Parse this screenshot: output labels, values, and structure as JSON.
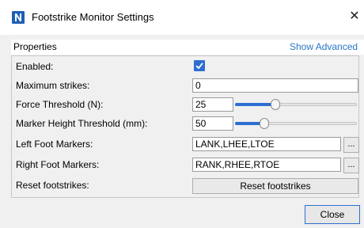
{
  "window": {
    "title": "Footstrike Monitor Settings",
    "close_symbol": "✕",
    "app_icon": "n-logo-icon"
  },
  "properties": {
    "header": "Properties",
    "show_advanced": "Show Advanced"
  },
  "rows": {
    "enabled": {
      "label": "Enabled:",
      "checked": true,
      "check_symbol": "✓"
    },
    "max_strikes": {
      "label": "Maximum strikes:",
      "value": "0"
    },
    "force": {
      "label": "Force Threshold (N):",
      "value": "25",
      "slider_fraction": 0.32
    },
    "marker_height": {
      "label": "Marker Height Threshold (mm):",
      "value": "50",
      "slider_fraction": 0.22
    },
    "left_foot": {
      "label": "Left Foot Markers:",
      "value": "LANK,LHEE,LTOE",
      "browse": "..."
    },
    "right_foot": {
      "label": "Right Foot Markers:",
      "value": "RANK,RHEE,RTOE",
      "browse": "..."
    },
    "reset": {
      "label": "Reset footstrikes:",
      "button": "Reset footstrikes"
    }
  },
  "footer": {
    "close_label": "Close"
  },
  "colors": {
    "accent": "#2d6fd1",
    "link": "#2a76c6",
    "icon_blue": "#1e5fb4"
  }
}
